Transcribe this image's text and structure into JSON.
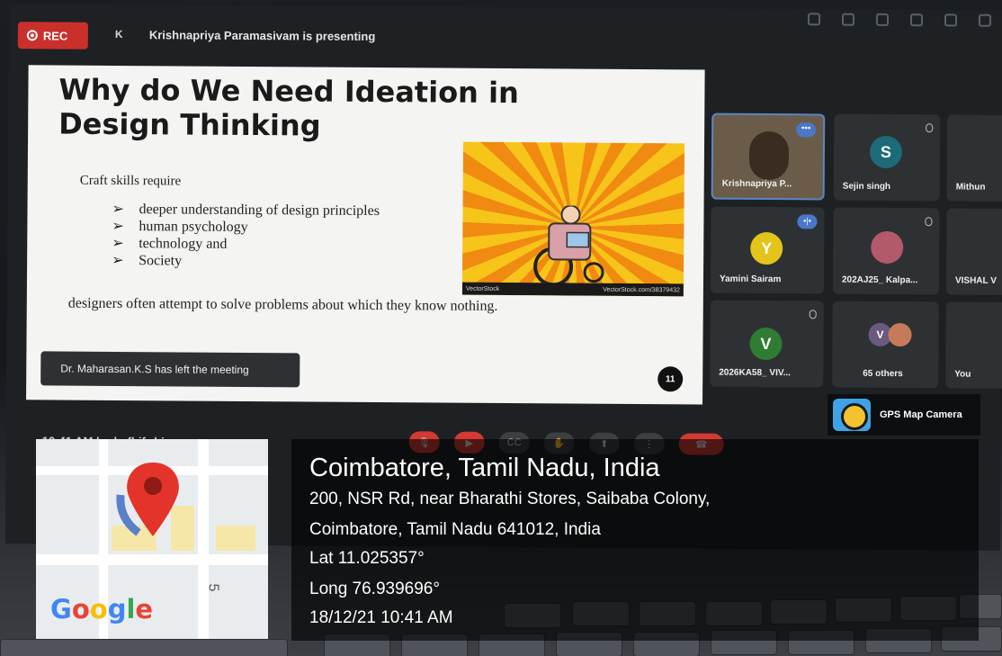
{
  "meeting": {
    "rec_label": "REC",
    "presenter_initial": "K",
    "presenter_text": "Krishnapriya Paramasivam is presenting",
    "time_code": "10:41 AM  |  pde-fbif-rbi",
    "toast": "Dr. Maharasan.K.S has left the meeting"
  },
  "slide": {
    "title": "Why do We Need Ideation in Design Thinking",
    "intro": "Craft skills require",
    "bullets": [
      "deeper understanding of design principles",
      "human psychology",
      "technology and",
      "Society"
    ],
    "body": "designers often attempt to solve problems about which they know nothing.",
    "page_number": "11",
    "image_watermark": "VectorStock",
    "image_caption": "VectorStock.com/38379432"
  },
  "participants": [
    {
      "name": "Krishnapriya P...",
      "initial": "",
      "color": "#7a6a55"
    },
    {
      "name": "Sejin singh",
      "initial": "S",
      "color": "#1d6a78"
    },
    {
      "name": "Mithun",
      "initial": "",
      "color": "#3a3d41"
    },
    {
      "name": "Yamini Sairam",
      "initial": "Y",
      "color": "#e4c41a"
    },
    {
      "name": "202AJ25_ Kalpa...",
      "initial": "",
      "color": "#3a3d41"
    },
    {
      "name": "VISHAL V",
      "initial": "",
      "color": "#3a3d41"
    },
    {
      "name": "2026KA58_ VIV...",
      "initial": "V",
      "color": "#2e7d32"
    },
    {
      "name": "65 others",
      "initial": "V",
      "color": "#6a5a80"
    },
    {
      "name": "You",
      "initial": "",
      "color": "#3a3d41"
    }
  ],
  "gps": {
    "app_name": "GPS Map Camera",
    "city": "Coimbatore, Tamil Nadu, India",
    "address_line1": "200, NSR Rd, near Bharathi Stores, Saibaba Colony,",
    "address_line2": "Coimbatore, Tamil Nadu 641012, India",
    "latitude": "Lat 11.025357°",
    "longitude": "Long 76.939696°",
    "datetime": "18/12/21 10:41 AM",
    "map_logo": "Google",
    "map_street_number": "5"
  },
  "colors": {
    "rec_red": "#c9302c",
    "end_call_red": "#d23a33",
    "google_blue": "#4285F4",
    "google_red": "#EA4335",
    "google_yellow": "#FBBC05",
    "google_green": "#34A853"
  }
}
